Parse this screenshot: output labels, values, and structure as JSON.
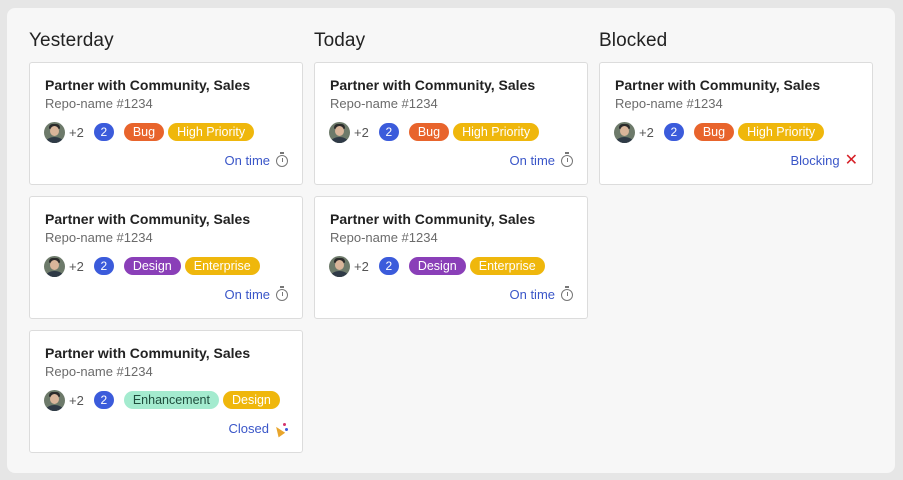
{
  "columns": [
    {
      "title": "Yesterday",
      "cards": [
        {
          "title": "Partner with Community, Sales",
          "repo": "Repo-name #1234",
          "plus": "+2",
          "count": "2",
          "tags": [
            {
              "label": "Bug",
              "kind": "bug"
            },
            {
              "label": "High Priority",
              "kind": "high"
            }
          ],
          "status": "On time",
          "status_icon": "stopwatch-icon"
        },
        {
          "title": "Partner with Community, Sales",
          "repo": "Repo-name #1234",
          "plus": "+2",
          "count": "2",
          "tags": [
            {
              "label": "Design",
              "kind": "design"
            },
            {
              "label": "Enterprise",
              "kind": "enterprise"
            }
          ],
          "status": "On time",
          "status_icon": "stopwatch-icon"
        },
        {
          "title": "Partner with Community, Sales",
          "repo": "Repo-name #1234",
          "plus": "+2",
          "count": "2",
          "tags": [
            {
              "label": "Enhancement",
              "kind": "enhancement"
            },
            {
              "label": "Design",
              "kind": "design-yellow"
            }
          ],
          "status": "Closed",
          "status_icon": "party-popper-icon"
        }
      ]
    },
    {
      "title": "Today",
      "cards": [
        {
          "title": "Partner with Community, Sales",
          "repo": "Repo-name #1234",
          "plus": "+2",
          "count": "2",
          "tags": [
            {
              "label": "Bug",
              "kind": "bug"
            },
            {
              "label": "High Priority",
              "kind": "high"
            }
          ],
          "status": "On time",
          "status_icon": "stopwatch-icon"
        },
        {
          "title": "Partner with Community, Sales",
          "repo": "Repo-name #1234",
          "plus": "+2",
          "count": "2",
          "tags": [
            {
              "label": "Design",
              "kind": "design"
            },
            {
              "label": "Enterprise",
              "kind": "enterprise"
            }
          ],
          "status": "On time",
          "status_icon": "stopwatch-icon"
        }
      ]
    },
    {
      "title": "Blocked",
      "cards": [
        {
          "title": "Partner with Community, Sales",
          "repo": "Repo-name #1234",
          "plus": "+2",
          "count": "2",
          "tags": [
            {
              "label": "Bug",
              "kind": "bug"
            },
            {
              "label": "High Priority",
              "kind": "high"
            }
          ],
          "status": "Blocking",
          "status_icon": "close-x-icon"
        }
      ]
    }
  ],
  "colors": {
    "count_badge": "#3b5bdb",
    "status_text": "#3a56c8",
    "tag_bug": "#e8642c",
    "tag_high_priority": "#efb70c",
    "tag_design": "#8a3fb8",
    "tag_enterprise": "#efb70c",
    "tag_enhancement": "#a4ebcf",
    "blocking_icon": "#d61f26"
  }
}
